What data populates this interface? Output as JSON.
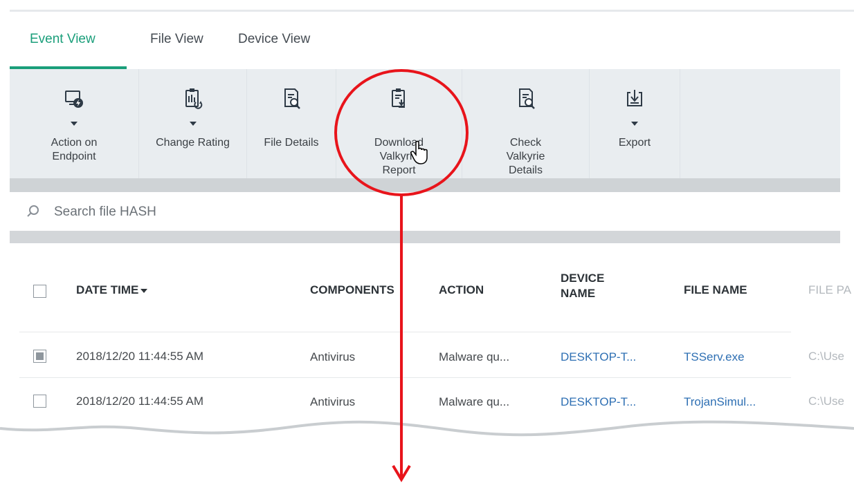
{
  "tabs": [
    {
      "label": "Event View",
      "active": true
    },
    {
      "label": "File View",
      "active": false
    },
    {
      "label": "Device View",
      "active": false
    }
  ],
  "toolbar": {
    "buttons": [
      {
        "label": "Action on Endpoint",
        "icon": "monitor-bolt-icon",
        "dropdown": true
      },
      {
        "label": "Change Rating",
        "icon": "clipboard-refresh-icon",
        "dropdown": true
      },
      {
        "label": "File Details",
        "icon": "document-search-icon",
        "dropdown": false
      },
      {
        "label": "Download Valkyrie Report",
        "icon": "clipboard-download-icon",
        "dropdown": false
      },
      {
        "label": "Check Valkyrie Details",
        "icon": "document-search-icon",
        "dropdown": false
      },
      {
        "label": "Export",
        "icon": "export-icon",
        "dropdown": true
      }
    ]
  },
  "search": {
    "placeholder": "Search file HASH",
    "value": ""
  },
  "table": {
    "columns": [
      "DATE TIME",
      "COMPONENTS",
      "ACTION",
      "DEVICE NAME",
      "FILE NAME",
      "FILE PA"
    ],
    "sorted_column": "DATE TIME",
    "rows": [
      {
        "checked": true,
        "date_time": "2018/12/20 11:44:55 AM",
        "component": "Antivirus",
        "action": "Malware qu...",
        "device": "DESKTOP-T...",
        "file_name": "TSServ.exe",
        "file_path": "C:\\Use"
      },
      {
        "checked": false,
        "date_time": "2018/12/20 11:44:55 AM",
        "component": "Antivirus",
        "action": "Malware qu...",
        "device": "DESKTOP-T...",
        "file_name": "TrojanSimul...",
        "file_path": "C:\\Use"
      }
    ]
  },
  "colors": {
    "accent": "#1a9e7a",
    "link": "#2e6fb3",
    "toolbar_bg": "#e9edf0",
    "annotation": "#e8141b"
  }
}
